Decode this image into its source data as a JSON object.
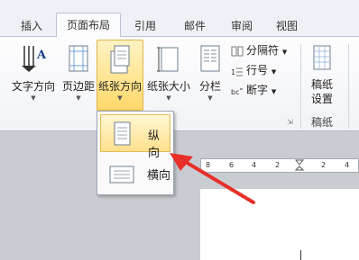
{
  "tabs": [
    "插入",
    "页面布局",
    "引用",
    "邮件",
    "审阅",
    "视图"
  ],
  "ribbon": {
    "text_direction": "文字方向",
    "margins": "页边距",
    "orientation": "纸张方向",
    "size": "纸张大小",
    "columns": "分栏",
    "breaks": "分隔符",
    "line_numbers": "行号",
    "hyphenation": "断字",
    "draft_settings_line1": "稿纸",
    "draft_settings_line2": "设置",
    "draft_group": "稿纸"
  },
  "orientation_menu": {
    "portrait": "纵向",
    "landscape": "横向"
  },
  "ruler_ticks": [
    "8",
    "6",
    "4",
    "2",
    "2",
    "4"
  ],
  "colors": {
    "accent": "#ffd86a",
    "arrow": "#e8302a"
  }
}
